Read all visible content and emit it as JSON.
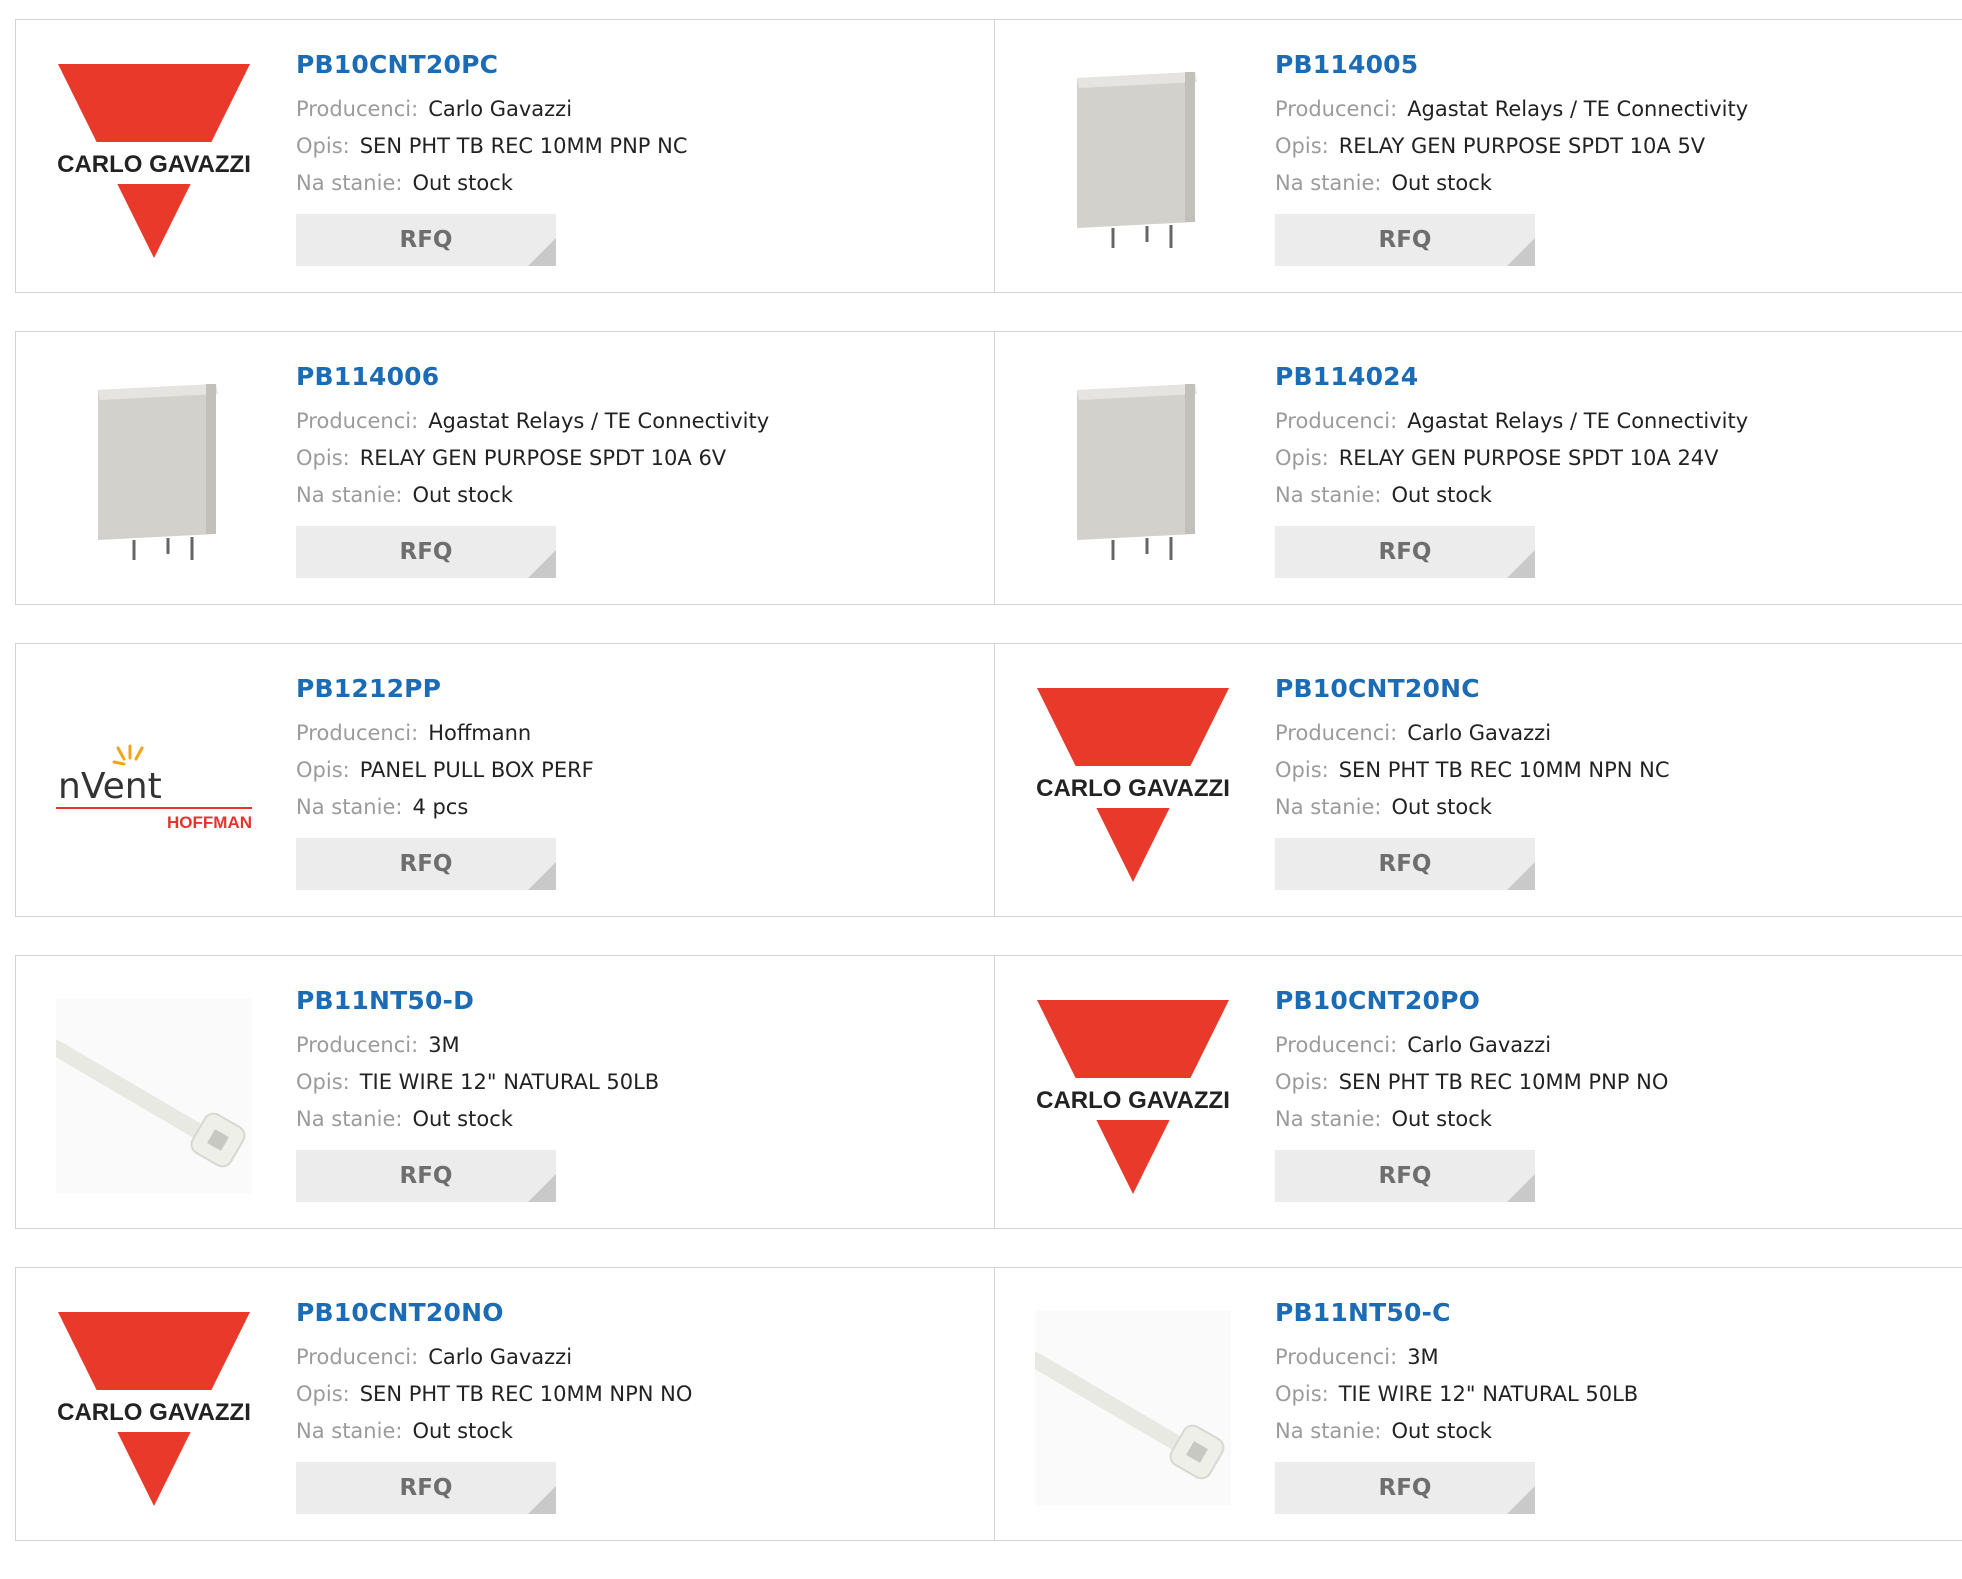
{
  "labels": {
    "manufacturer": "Producenci:",
    "description": "Opis:",
    "stock": "Na stanie:",
    "rfq": "RFQ"
  },
  "products": [
    {
      "pn": "PB10CNT20PC",
      "manufacturer": "Carlo Gavazzi",
      "description": "SEN PHT TB REC 10MM PNP NC",
      "stock": "Out stock",
      "image": "carlo-gavazzi-logo"
    },
    {
      "pn": "PB114005",
      "manufacturer": "Agastat Relays / TE Connectivity",
      "description": "RELAY GEN PURPOSE SPDT 10A 5V",
      "stock": "Out stock",
      "image": "relay-photo"
    },
    {
      "pn": "PB114006",
      "manufacturer": "Agastat Relays / TE Connectivity",
      "description": "RELAY GEN PURPOSE SPDT 10A 6V",
      "stock": "Out stock",
      "image": "relay-photo"
    },
    {
      "pn": "PB114024",
      "manufacturer": "Agastat Relays / TE Connectivity",
      "description": "RELAY GEN PURPOSE SPDT 10A 24V",
      "stock": "Out stock",
      "image": "relay-photo"
    },
    {
      "pn": "PB1212PP",
      "manufacturer": "Hoffmann",
      "description": "PANEL PULL BOX PERF",
      "stock": "4 pcs",
      "image": "nvent-hoffman-logo"
    },
    {
      "pn": "PB10CNT20NC",
      "manufacturer": "Carlo Gavazzi",
      "description": "SEN PHT TB REC 10MM NPN NC",
      "stock": "Out stock",
      "image": "carlo-gavazzi-logo"
    },
    {
      "pn": "PB11NT50-D",
      "manufacturer": "3M",
      "description": "TIE WIRE 12\" NATURAL 50LB",
      "stock": "Out stock",
      "image": "cable-tie-photo"
    },
    {
      "pn": "PB10CNT20PO",
      "manufacturer": "Carlo Gavazzi",
      "description": "SEN PHT TB REC 10MM PNP NO",
      "stock": "Out stock",
      "image": "carlo-gavazzi-logo"
    },
    {
      "pn": "PB10CNT20NO",
      "manufacturer": "Carlo Gavazzi",
      "description": "SEN PHT TB REC 10MM NPN NO",
      "stock": "Out stock",
      "image": "carlo-gavazzi-logo"
    },
    {
      "pn": "PB11NT50-C",
      "manufacturer": "3M",
      "description": "TIE WIRE 12\" NATURAL 50LB",
      "stock": "Out stock",
      "image": "cable-tie-photo"
    }
  ],
  "logos": {
    "carlo_gavazzi_text": "CARLO GAVAZZI",
    "nvent_text": "nVent",
    "hoffman_text": "HOFFMAN"
  },
  "colors": {
    "link": "#1c6bb5",
    "gavazzi_red": "#e8392b",
    "nvent_red": "#e3342f"
  }
}
